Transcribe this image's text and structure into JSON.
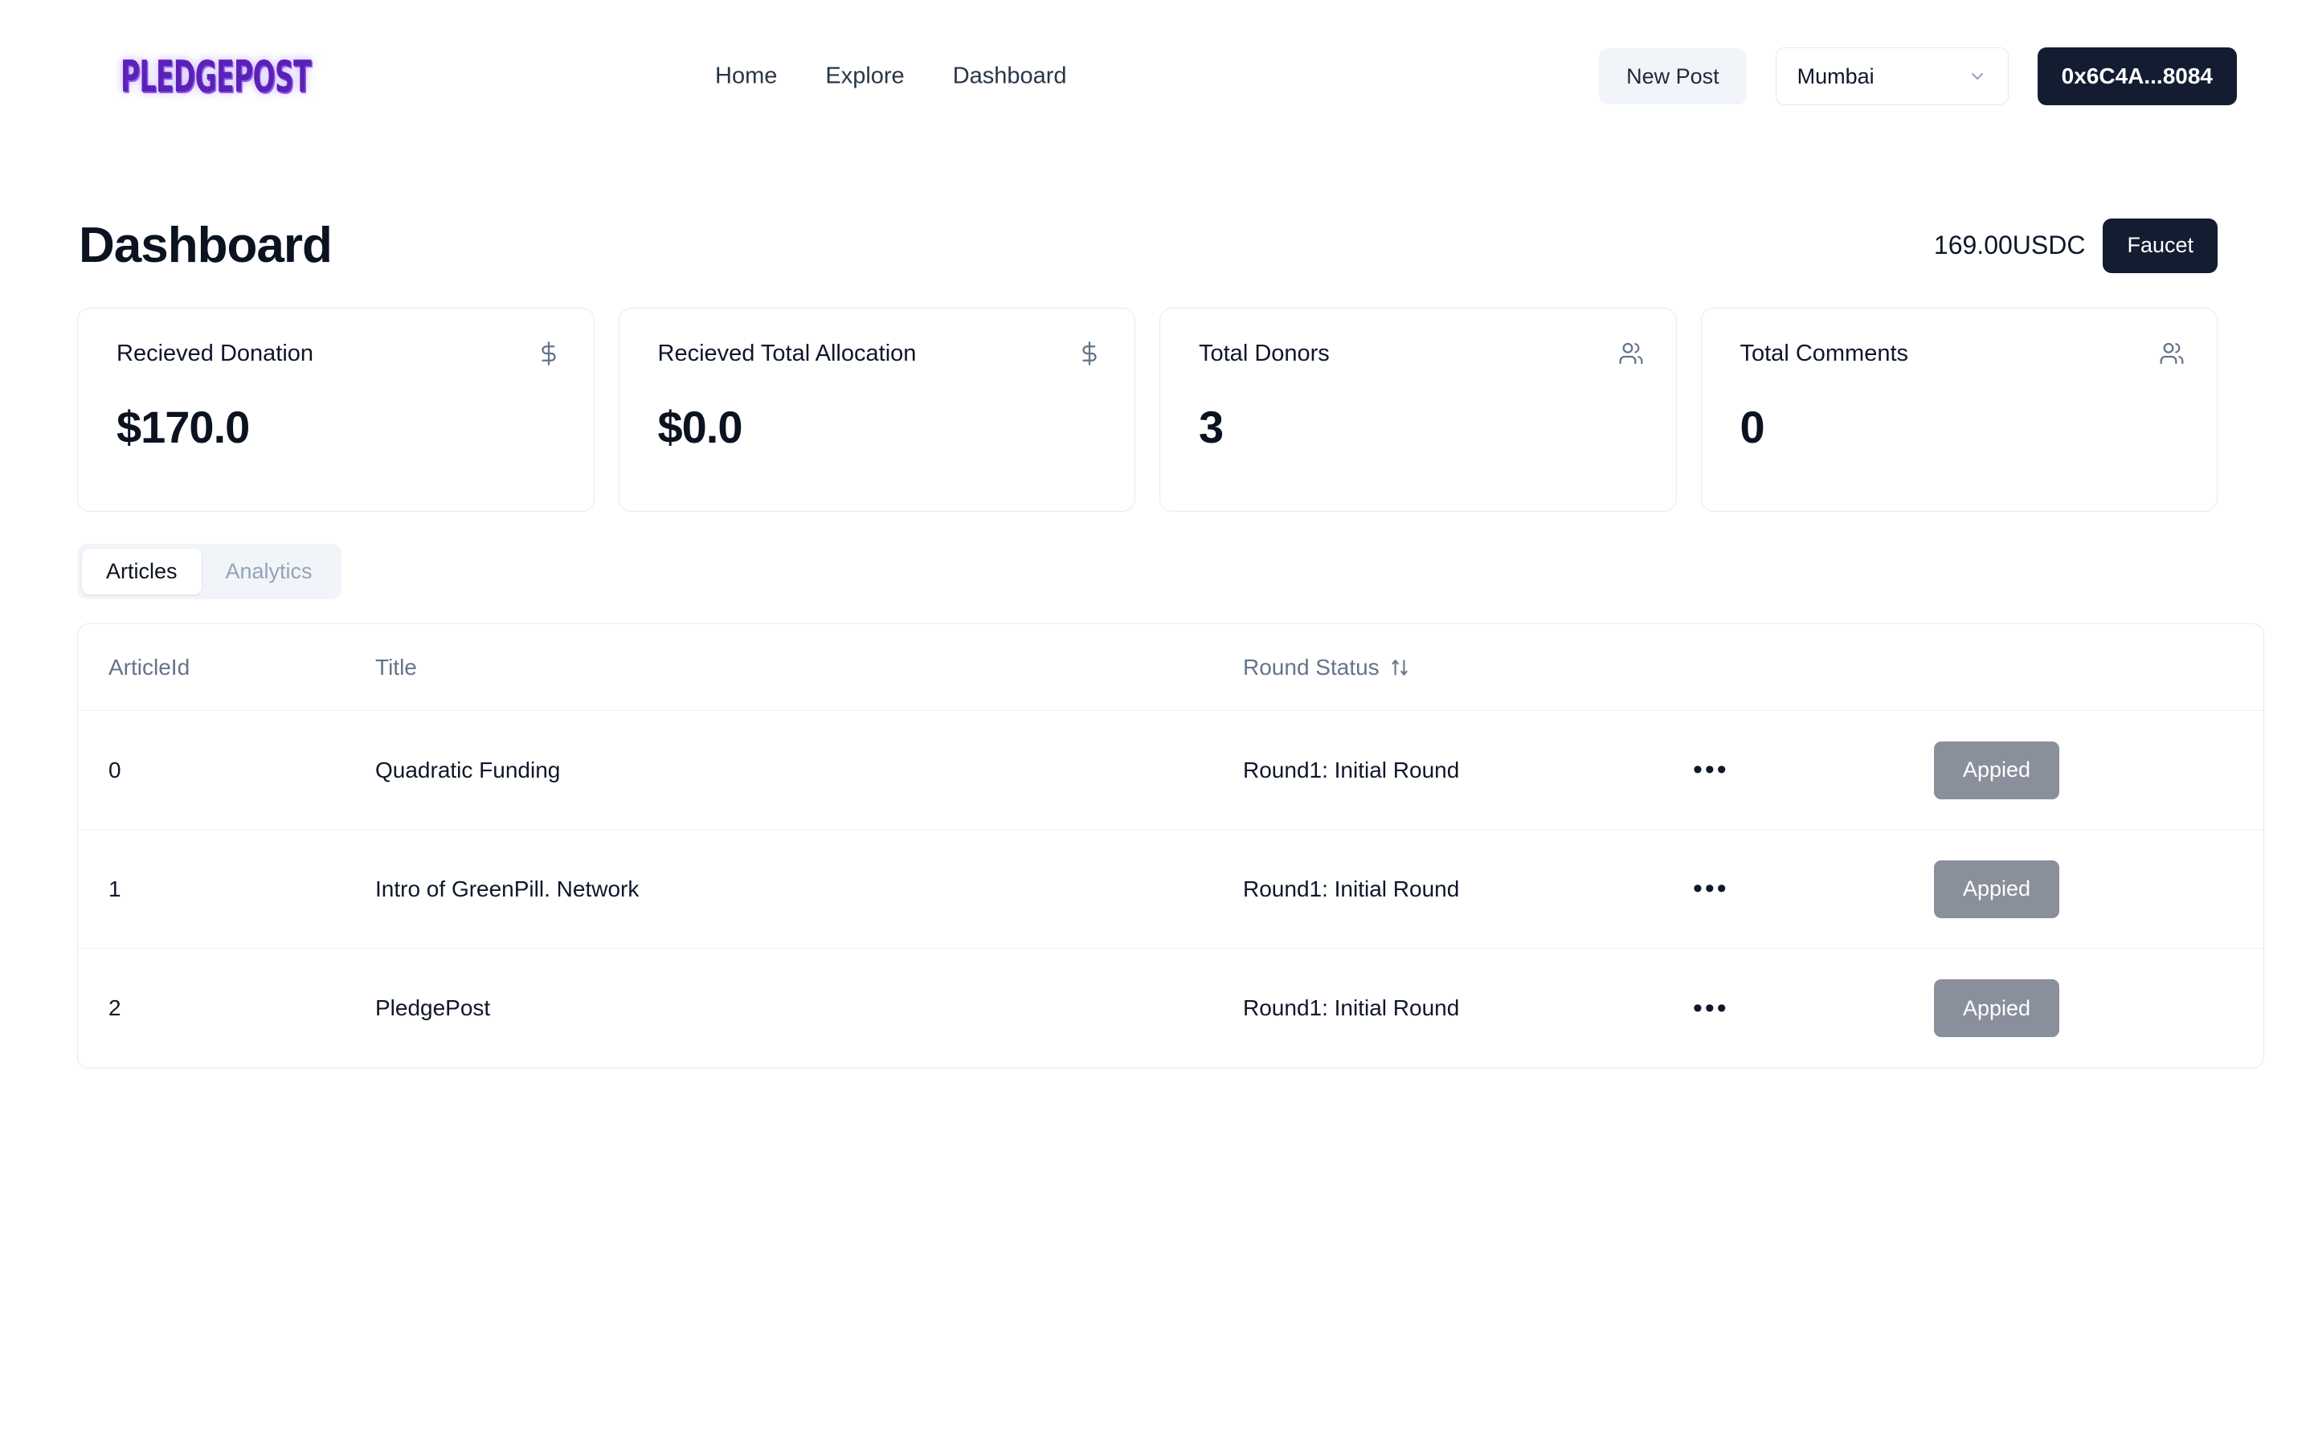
{
  "header": {
    "logo_text": "PLEDGEPOST",
    "nav": [
      {
        "label": "Home"
      },
      {
        "label": "Explore"
      },
      {
        "label": "Dashboard"
      }
    ],
    "new_post_label": "New Post",
    "network_select": {
      "value": "Mumbai",
      "icon": "chevron-down-icon"
    },
    "wallet_label": "0x6C4A...8084"
  },
  "page": {
    "title": "Dashboard",
    "balance": "169.00USDC",
    "faucet_label": "Faucet"
  },
  "stats": [
    {
      "label": "Recieved Donation",
      "value": "$170.0",
      "icon": "dollar-icon"
    },
    {
      "label": "Recieved Total Allocation",
      "value": "$0.0",
      "icon": "dollar-icon"
    },
    {
      "label": "Total Donors",
      "value": "3",
      "icon": "users-icon"
    },
    {
      "label": "Total Comments",
      "value": "0",
      "icon": "users-icon"
    }
  ],
  "tabs": [
    {
      "label": "Articles",
      "active": true
    },
    {
      "label": "Analytics",
      "active": false
    }
  ],
  "table": {
    "columns": {
      "article_id": "ArticleId",
      "title": "Title",
      "round_status": "Round Status",
      "sort_icon": "sort-updown-icon"
    },
    "rows": [
      {
        "id": "0",
        "title": "Quadratic Funding",
        "round_status": "Round1: Initial Round",
        "menu": "•••",
        "action": "Appied"
      },
      {
        "id": "1",
        "title": "Intro of GreenPill. Network",
        "round_status": "Round1: Initial Round",
        "menu": "•••",
        "action": "Appied"
      },
      {
        "id": "2",
        "title": "PledgePost",
        "round_status": "Round1: Initial Round",
        "menu": "•••",
        "action": "Appied"
      }
    ]
  },
  "colors": {
    "brand_purple": "#5b21b6",
    "dark_button": "#131c31",
    "applied_gray": "#8a8f9c",
    "muted_text": "#64748b",
    "border": "#e6ebf1"
  }
}
